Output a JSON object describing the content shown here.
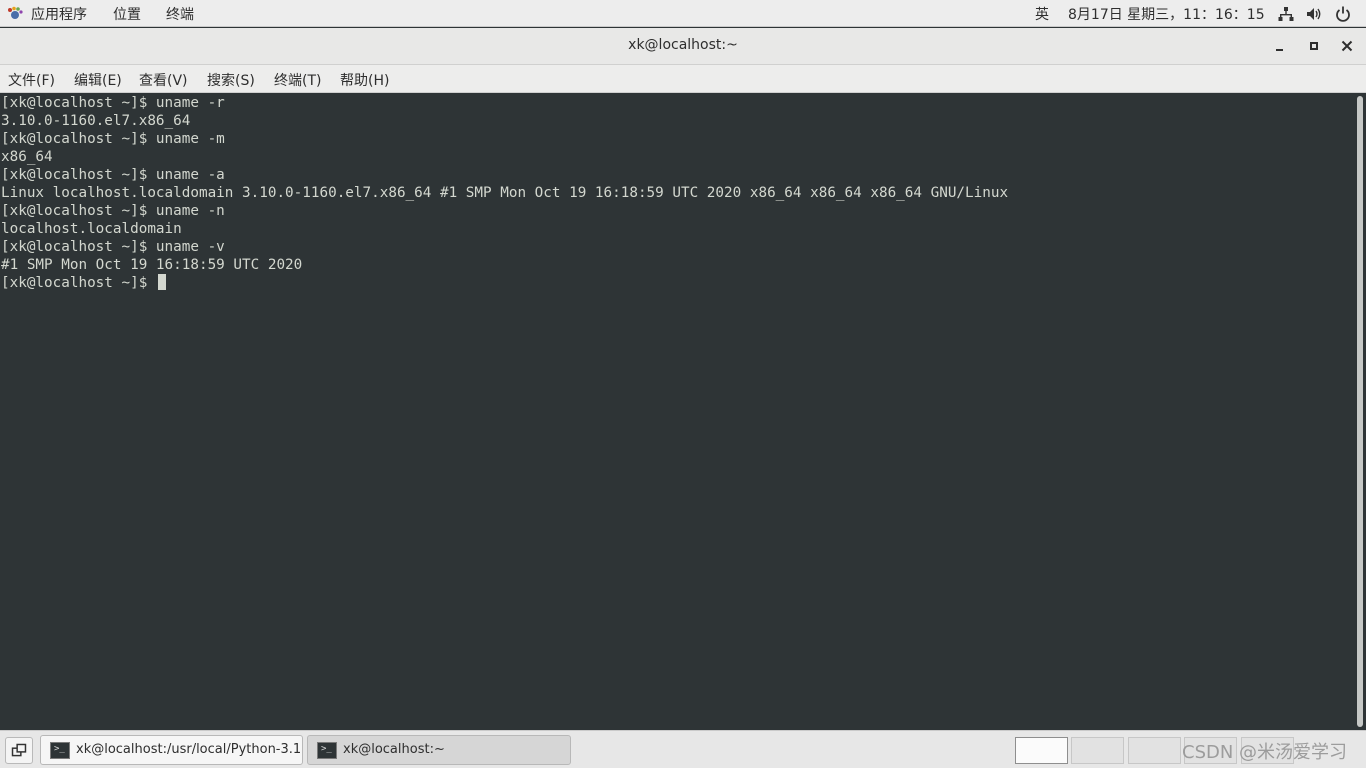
{
  "top_panel": {
    "apps_label": "应用程序",
    "places_label": "位置",
    "terminal_label": "终端",
    "ime_label": "英",
    "clock": "8月17日 星期三，11：16：15"
  },
  "window": {
    "title": "xk@localhost:~"
  },
  "menubar": {
    "items": [
      "文件(F)",
      "编辑(E)",
      "查看(V)",
      "搜索(S)",
      "终端(T)",
      "帮助(H)"
    ]
  },
  "terminal": {
    "lines": [
      "[xk@localhost ~]$ uname -r",
      "3.10.0-1160.el7.x86_64",
      "[xk@localhost ~]$ uname -m",
      "x86_64",
      "[xk@localhost ~]$ uname -a",
      "Linux localhost.localdomain 3.10.0-1160.el7.x86_64 #1 SMP Mon Oct 19 16:18:59 UTC 2020 x86_64 x86_64 x86_64 GNU/Linux",
      "[xk@localhost ~]$ uname -n",
      "localhost.localdomain",
      "[xk@localhost ~]$ uname -v",
      "#1 SMP Mon Oct 19 16:18:59 UTC 2020"
    ],
    "prompt": "[xk@localhost ~]$ "
  },
  "taskbar": {
    "tasks": [
      {
        "label": "xk@localhost:/usr/local/Python-3.1…"
      },
      {
        "label": "xk@localhost:~"
      }
    ],
    "watermark": "CSDN @米汤爱学习"
  },
  "colors": {
    "terminal_bg": "#2e3436",
    "terminal_fg": "#d3d7cf",
    "panel_bg": "#ededed"
  }
}
